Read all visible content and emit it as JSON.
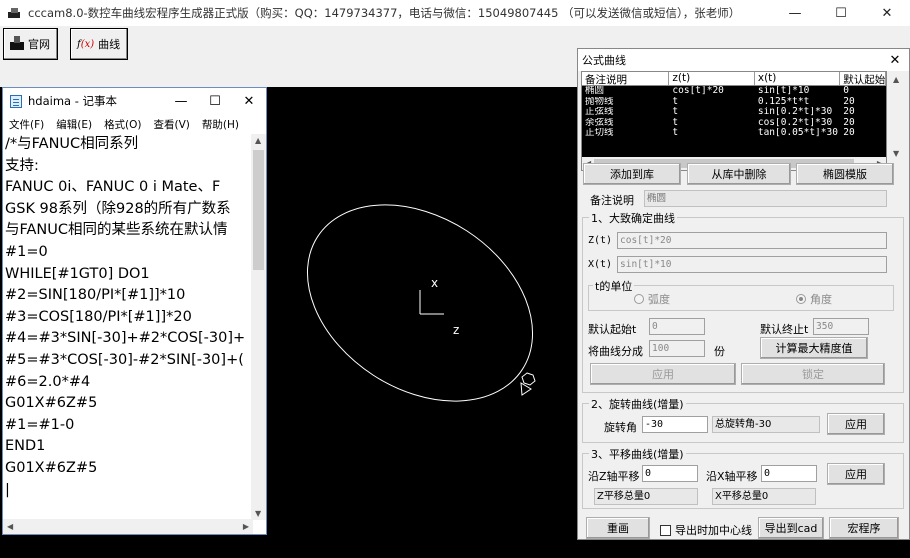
{
  "app": {
    "title": "cccam8.0-数控车曲线宏程序生成器正式版（购买：QQ：1479734377，电话与微信：15049807445 （可以发送微信或短信），张老师）",
    "controls": {
      "minimize": "—",
      "maximize": "☐",
      "close": "✕"
    }
  },
  "toolbar": {
    "site_label": "官网",
    "curve_label": "曲线",
    "curve_icon": "f(x)"
  },
  "notepad": {
    "title": "hdaima - 记事本",
    "menu": [
      "文件(F)",
      "编辑(E)",
      "格式(O)",
      "查看(V)",
      "帮助(H)"
    ],
    "lines": [
      "/*与FANUC相同系列",
      "支持:",
      "FANUC 0i、FANUC 0 i Mate、F",
      "GSK 98系列（除928的所有广数系",
      "与FANUC相同的某些系统在默认情",
      "#1=0",
      "WHILE[#1GT0] DO1",
      "#2=SIN[180/PI*[#1]]*10",
      "#3=COS[180/PI*[#1]]*20",
      "#4=#3*SIN[-30]+#2*COS[-30]+",
      "#5=#3*COS[-30]-#2*SIN[-30]+(",
      "#6=2.0*#4",
      "G01X#6Z#5",
      "#1=#1-0",
      "END1",
      "G01X#6Z#5",
      "|"
    ]
  },
  "canvas": {
    "axis_x_label": "x",
    "axis_z_label": "z",
    "curve_color": "#ffffff"
  },
  "dialog": {
    "title": "公式曲线",
    "close": "✕",
    "grid": {
      "headers": [
        "备注说明",
        "z(t)",
        "x(t)",
        "默认起始"
      ],
      "rows": [
        [
          "椭圆",
          "cos[t]*20",
          "sin[t]*10",
          "0"
        ],
        [
          "抛物线",
          "t",
          "0.125*t*t",
          "20"
        ],
        [
          "正弦线",
          "t",
          "sin[0.2*t]*30",
          "20"
        ],
        [
          "余弦线",
          "t",
          "cos[0.2*t]*30",
          "20"
        ],
        [
          "正切线",
          "t",
          "tan[0.05*t]*30",
          "20"
        ]
      ]
    },
    "buttons": {
      "add": "添加到库",
      "delete": "从库中删除",
      "template": "椭圆模版",
      "calc_precision": "计算最大精度值",
      "apply1": "应用",
      "lock": "锁定",
      "apply2": "应用",
      "apply3": "应用",
      "redraw": "重画",
      "export_cad": "导出到cad",
      "macro": "宏程序"
    },
    "remark_label": "备注说明",
    "remark_value": "椭圆",
    "group1": {
      "title": "1、大致确定曲线",
      "zt_label": "Z(t)",
      "zt_value": "cos[t]*20",
      "xt_label": "X(t)",
      "xt_value": "sin[t]*10",
      "unit_title": "t的单位",
      "radian": "弧度",
      "degree": "角度",
      "start_label": "默认起始t",
      "start_value": "0",
      "end_label": "默认终止t",
      "end_value": "350",
      "divide_label": "将曲线分成",
      "divide_value": "100",
      "divide_unit": "份"
    },
    "group2": {
      "title": "2、旋转曲线(增量)",
      "angle_label": "旋转角",
      "angle_value": "-30",
      "total_angle": "总旋转角-30"
    },
    "group3": {
      "title": "3、平移曲线(增量)",
      "z_shift_label": "沿Z轴平移",
      "z_shift_value": "0",
      "x_shift_label": "沿X轴平移",
      "x_shift_value": "0",
      "z_total": "Z平移总量0",
      "x_total": "X平移总量0"
    },
    "center_line_label": "导出时加中心线"
  }
}
